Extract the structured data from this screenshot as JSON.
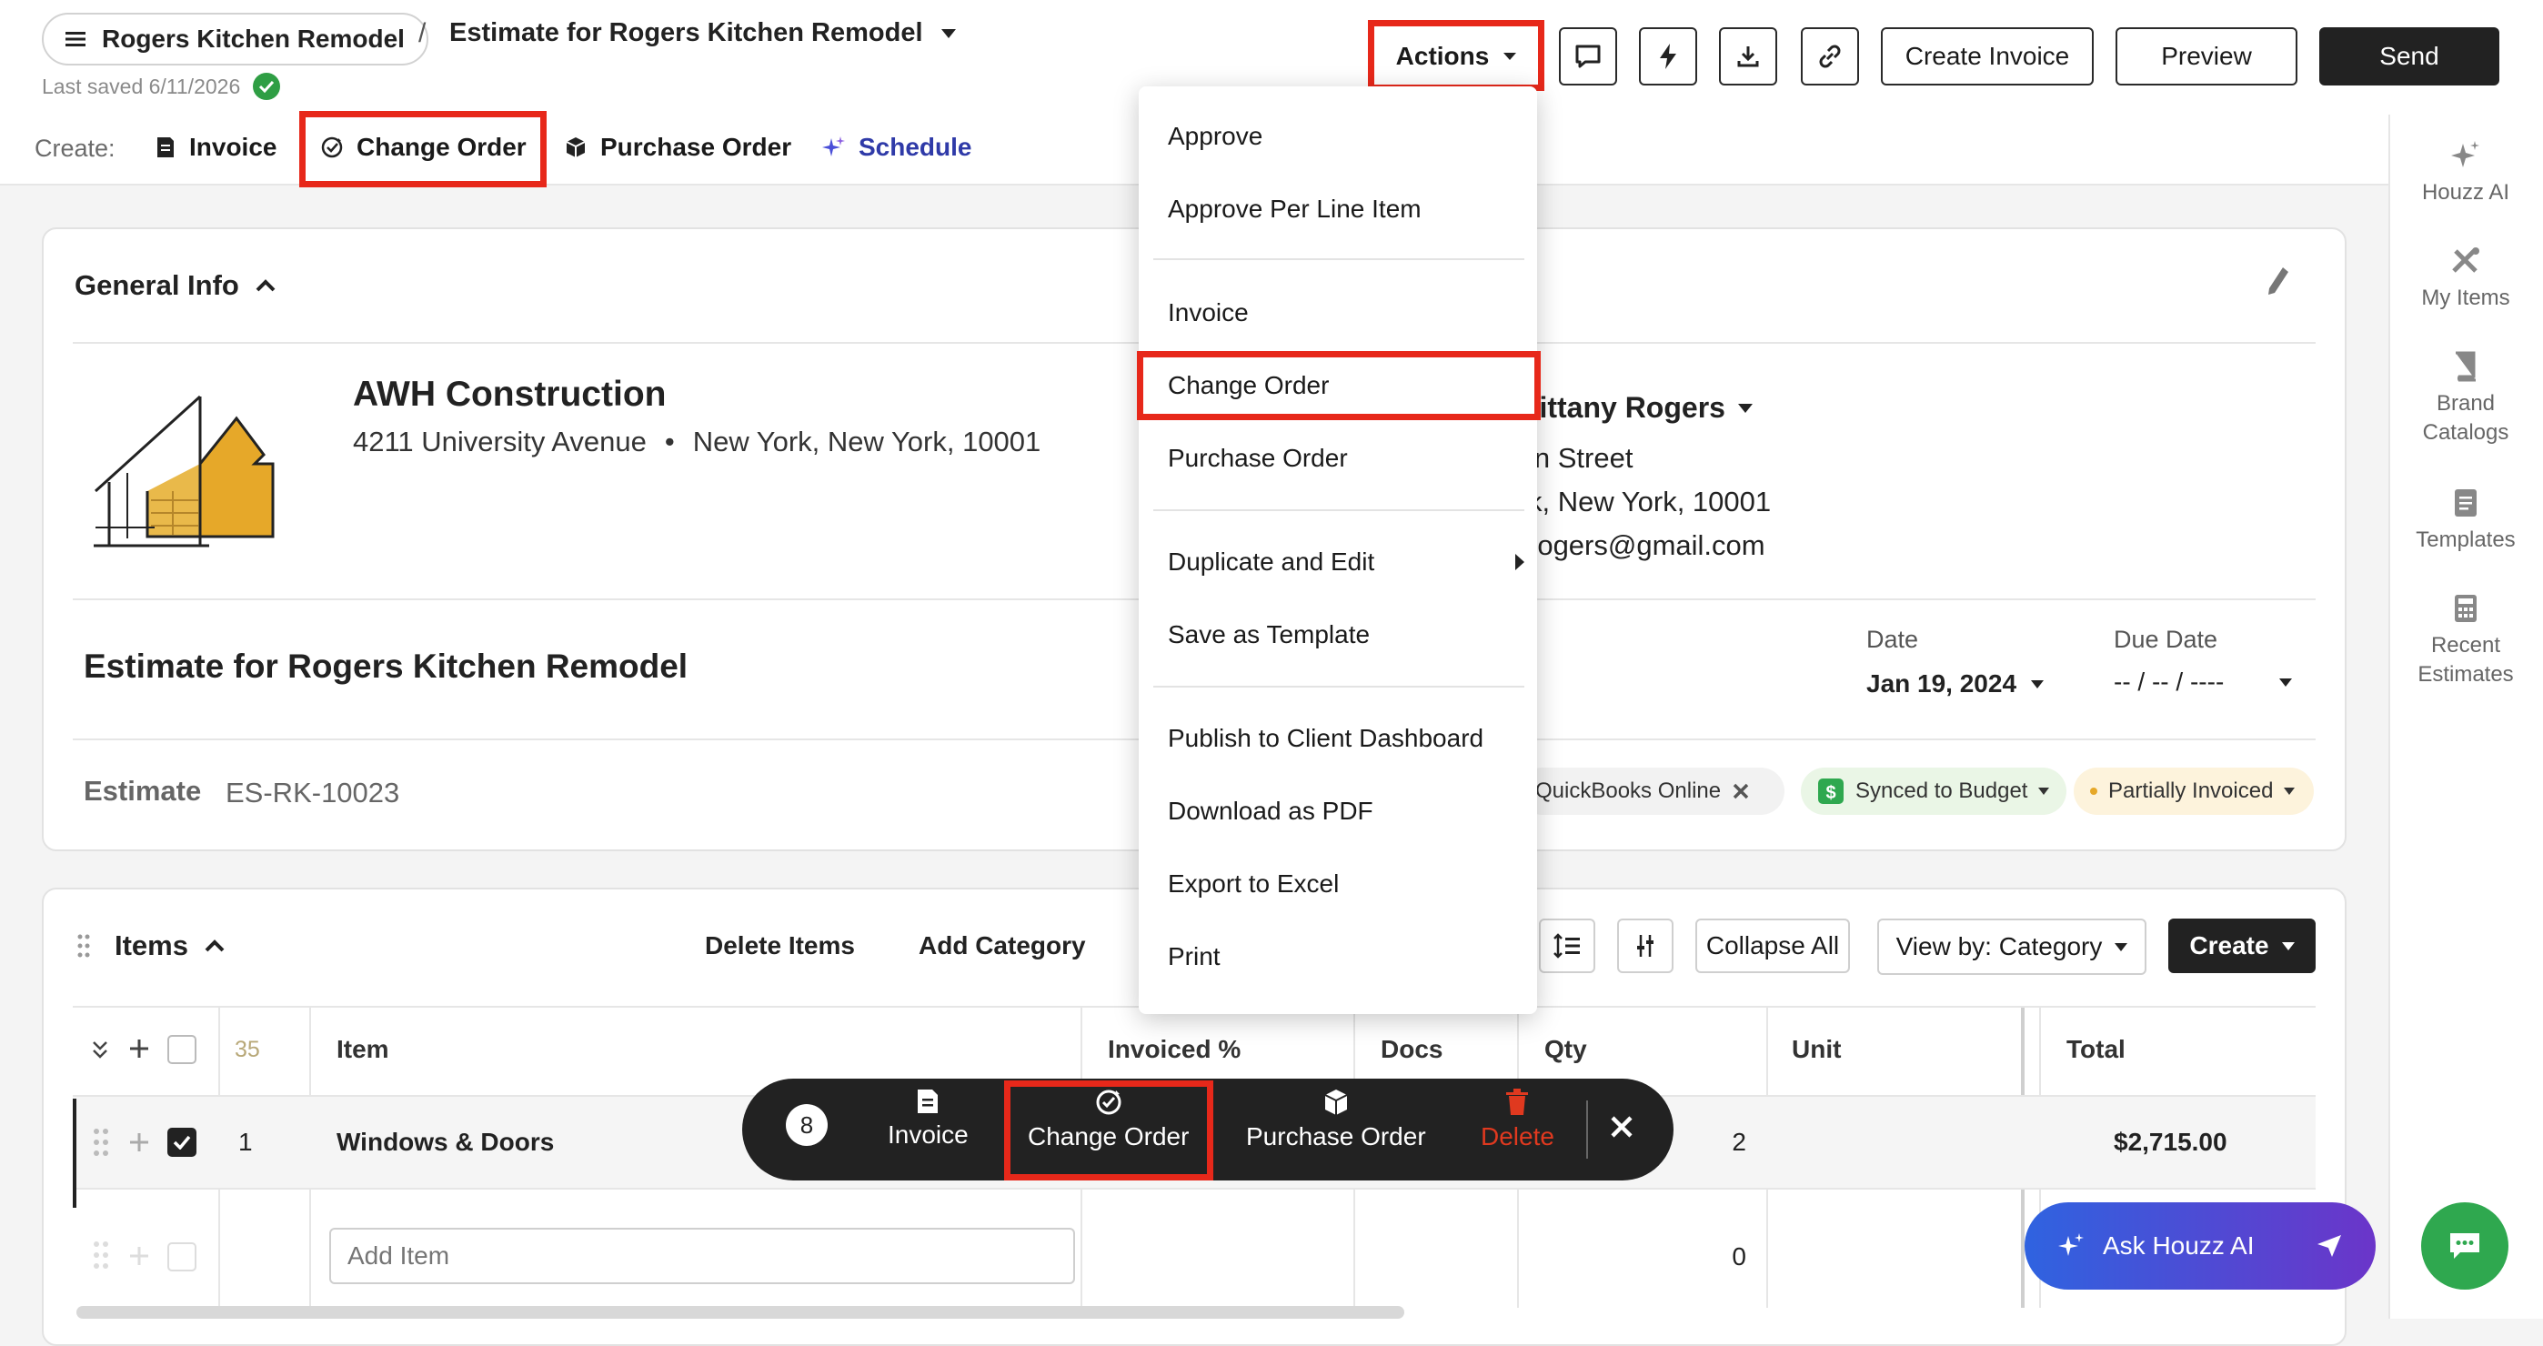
{
  "header": {
    "project_name": "Rogers Kitchen Remodel",
    "breadcrumb_separator": "/",
    "document_title": "Estimate for Rogers Kitchen Remodel",
    "last_saved": "Last saved 6/11/2026",
    "actions_label": "Actions",
    "create_invoice_label": "Create Invoice",
    "preview_label": "Preview",
    "send_label": "Send",
    "icon_buttons": [
      "comment-icon",
      "lightning-icon",
      "download-icon",
      "link-icon"
    ]
  },
  "create_bar": {
    "label": "Create:",
    "items": [
      {
        "label": "Invoice",
        "icon": "invoice-icon"
      },
      {
        "label": "Change Order",
        "icon": "change-order-icon"
      },
      {
        "label": "Purchase Order",
        "icon": "box-icon"
      },
      {
        "label": "Schedule",
        "icon": "sparkle-icon",
        "color": "#2f3aa8"
      }
    ]
  },
  "general_info": {
    "title": "General Info",
    "company_name": "AWH Construction",
    "company_street": "4211 University Avenue",
    "company_city": "New York, New York, 10001",
    "client_name": "rittany Rogers",
    "client_street": "in Street",
    "client_city": "k, New York, 10001",
    "client_email": "rogers@gmail.com",
    "estimate_title": "Estimate for Rogers Kitchen Remodel",
    "date_label": "Date",
    "date_value": "Jan 19, 2024",
    "due_date_label": "Due Date",
    "due_date_value": "-- / -- / ----",
    "estimate_label": "Estimate",
    "estimate_number": "ES-RK-10023",
    "tags": {
      "quickbooks": "QuickBooks Online",
      "budget": "Synced to Budget",
      "invoiced": "Partially Invoiced"
    }
  },
  "items": {
    "title": "Items",
    "delete_items": "Delete Items",
    "add_category": "Add Category",
    "collapse_all": "Collapse All",
    "view_by": "View by: Category",
    "create": "Create",
    "row_count": "35",
    "columns": {
      "item": "Item",
      "invoiced": "Invoiced %",
      "docs": "Docs",
      "qty": "Qty",
      "unit": "Unit",
      "total": "Total"
    },
    "rows": [
      {
        "num": "1",
        "name": "Windows & Doors",
        "qty": "2",
        "total": "$2,715.00",
        "checked": true
      }
    ],
    "add_item_placeholder": "Add Item",
    "add_row_qty": "0"
  },
  "actions_menu": {
    "items": [
      "Approve",
      "Approve Per Line Item",
      "Invoice",
      "Change Order",
      "Purchase Order",
      "Duplicate and Edit",
      "Save as Template",
      "Publish to Client Dashboard",
      "Download as PDF",
      "Export to Excel",
      "Print"
    ]
  },
  "floating_bar": {
    "count": "8",
    "invoice": "Invoice",
    "change_order": "Change Order",
    "purchase_order": "Purchase Order",
    "delete": "Delete",
    "delete_color": "#e0391f"
  },
  "right_rail": {
    "items": [
      {
        "label": "Houzz AI",
        "icon": "sparkle-icon"
      },
      {
        "label": "My Items",
        "icon": "tools-icon"
      },
      {
        "label": "Brand Catalogs",
        "icon": "book-icon"
      },
      {
        "label": "Templates",
        "icon": "template-icon"
      },
      {
        "label": "Recent Estimates",
        "icon": "calculator-icon"
      }
    ]
  },
  "ask_ai": {
    "label": "Ask Houzz AI"
  },
  "colors": {
    "highlight": "#e7281a",
    "primary": "#222222",
    "ai_gradient_start": "#2f63e0",
    "ai_gradient_end": "#6b35c9",
    "chat": "#2fa84f"
  }
}
